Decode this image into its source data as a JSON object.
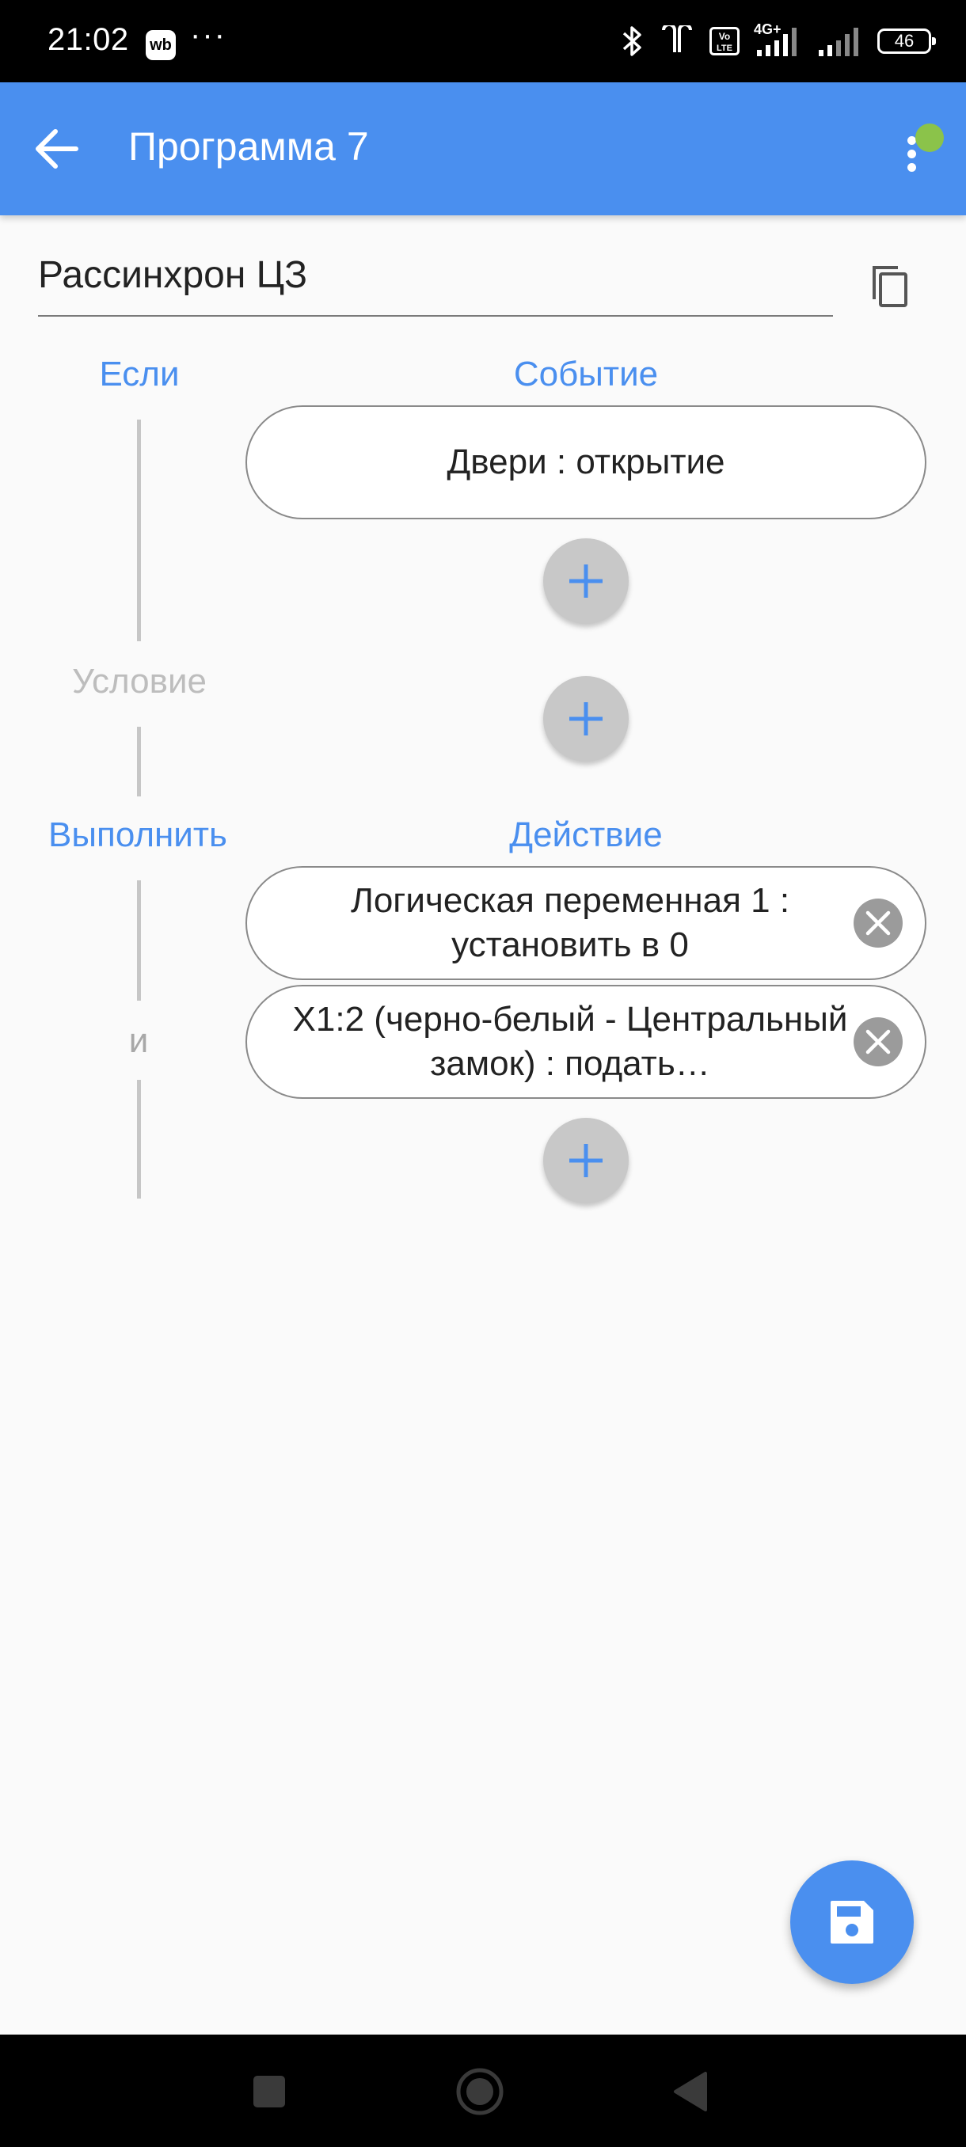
{
  "status_bar": {
    "time": "21:02",
    "app_badge": "wb",
    "more": "···",
    "network": "4G+",
    "battery": "46"
  },
  "app_bar": {
    "title": "Программа 7"
  },
  "program": {
    "name": "Рассинхрон ЦЗ"
  },
  "labels": {
    "if": "Если",
    "event": "Событие",
    "condition": "Условие",
    "execute": "Выполнить",
    "action": "Действие",
    "and": "и"
  },
  "events": [
    {
      "text": "Двери : открытие"
    }
  ],
  "actions": [
    {
      "text": "Логическая переменная 1 : установить в 0"
    },
    {
      "text": "X1:2 (черно-белый - Центральный замок) : подать…"
    }
  ],
  "colors": {
    "primary": "#4a8fef",
    "connection_indicator": "#8bc34a",
    "inactive_label": "#bdbdbd",
    "add_button": "#c8c8c8"
  },
  "icons": {
    "back": "arrow-left-icon",
    "menu": "more-vert-icon",
    "copy": "copy-icon",
    "add": "plus-icon",
    "remove": "close-icon",
    "save": "save-icon"
  }
}
